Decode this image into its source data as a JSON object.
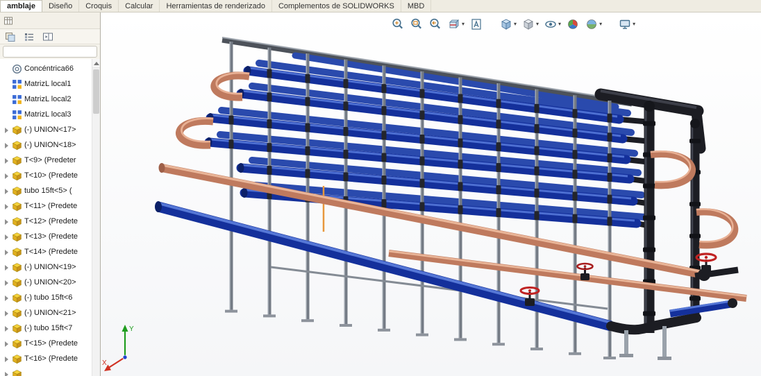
{
  "command_tabs": {
    "items": [
      {
        "label": "amblaje",
        "active": true
      },
      {
        "label": "Diseño",
        "active": false
      },
      {
        "label": "Croquis",
        "active": false
      },
      {
        "label": "Calcular",
        "active": false
      },
      {
        "label": "Herramientas de renderizado",
        "active": false
      },
      {
        "label": "Complementos de SOLIDWORKS",
        "active": false
      },
      {
        "label": "MBD",
        "active": false
      }
    ]
  },
  "feature_tree": {
    "items": [
      {
        "label": "Concéntrica66",
        "icon": "mate-concentric-icon",
        "expandable": false
      },
      {
        "label": "MatrizL local1",
        "icon": "linear-pattern-icon",
        "expandable": false
      },
      {
        "label": "MatrizL local2",
        "icon": "linear-pattern-icon",
        "expandable": false
      },
      {
        "label": "MatrizL local3",
        "icon": "linear-pattern-icon",
        "expandable": false
      },
      {
        "label": "(-) UNION<17>",
        "icon": "part-icon",
        "expandable": true
      },
      {
        "label": "(-) UNION<18>",
        "icon": "part-icon",
        "expandable": true
      },
      {
        "label": "T<9> (Predeter",
        "icon": "part-icon",
        "expandable": true
      },
      {
        "label": "T<10> (Predete",
        "icon": "part-icon",
        "expandable": true
      },
      {
        "label": "tubo 15ft<5> (",
        "icon": "part-icon",
        "expandable": true
      },
      {
        "label": "T<11> (Predete",
        "icon": "part-icon",
        "expandable": true
      },
      {
        "label": "T<12> (Predete",
        "icon": "part-icon",
        "expandable": true
      },
      {
        "label": "T<13> (Predete",
        "icon": "part-icon",
        "expandable": true
      },
      {
        "label": "T<14> (Predete",
        "icon": "part-icon",
        "expandable": true
      },
      {
        "label": "(-) UNION<19>",
        "icon": "part-icon",
        "expandable": true
      },
      {
        "label": "(-) UNION<20>",
        "icon": "part-icon",
        "expandable": true
      },
      {
        "label": "(-) tubo 15ft<6",
        "icon": "part-icon",
        "expandable": true
      },
      {
        "label": "(-) UNION<21>",
        "icon": "part-icon",
        "expandable": true
      },
      {
        "label": "(-) tubo 15ft<7",
        "icon": "part-icon",
        "expandable": true
      },
      {
        "label": "T<15> (Predete",
        "icon": "part-icon",
        "expandable": true
      },
      {
        "label": "T<16> (Predete",
        "icon": "part-icon",
        "expandable": true
      },
      {
        "label": "",
        "icon": "part-icon",
        "expandable": true
      }
    ]
  },
  "viewport_toolbar": {
    "items": [
      {
        "name": "zoom-fit-icon",
        "caret": false,
        "gap_before": false
      },
      {
        "name": "zoom-area-icon",
        "caret": false,
        "gap_before": false
      },
      {
        "name": "previous-view-icon",
        "caret": false,
        "gap_before": false
      },
      {
        "name": "section-view-icon",
        "caret": true,
        "gap_before": false
      },
      {
        "name": "annotation-view-icon",
        "caret": false,
        "gap_before": false
      },
      {
        "name": "view-orientation-icon",
        "caret": true,
        "gap_before": true
      },
      {
        "name": "display-style-icon",
        "caret": true,
        "gap_before": false
      },
      {
        "name": "hide-show-items-icon",
        "caret": true,
        "gap_before": false
      },
      {
        "name": "edit-appearance-icon",
        "caret": false,
        "gap_before": false
      },
      {
        "name": "apply-scene-icon",
        "caret": true,
        "gap_before": false
      },
      {
        "name": "view-settings-icon",
        "caret": true,
        "gap_before": true
      }
    ]
  },
  "triad": {
    "x_label": "X",
    "y_label": "Y"
  },
  "colors": {
    "pipe_blue": "#14309b",
    "pipe_copper": "#bf7a5e",
    "frame_gray": "#747b85",
    "fitting_black": "#1c1d23",
    "valve_red": "#c02323",
    "tab_bar_bg": "#efece2"
  }
}
